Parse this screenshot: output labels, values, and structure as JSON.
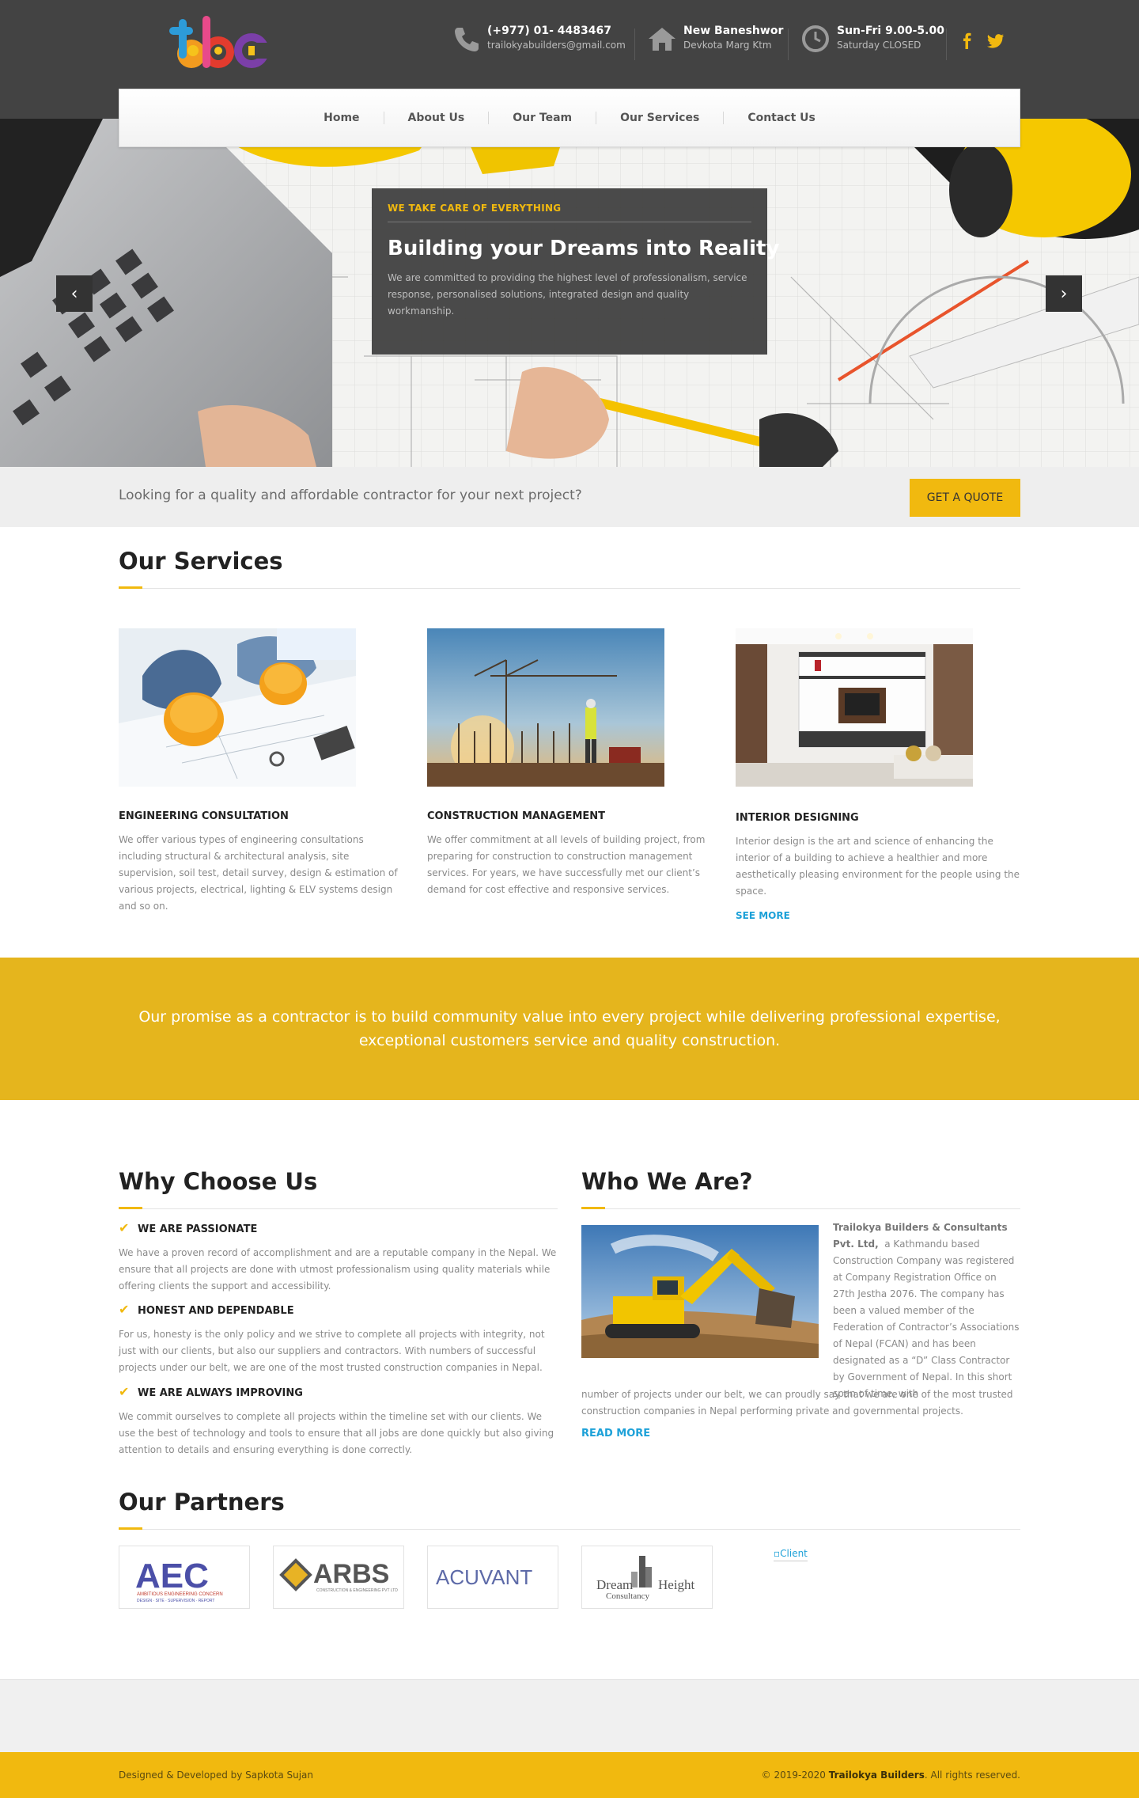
{
  "brand": {
    "logo_text": "tbc",
    "accent": "#f1b90f"
  },
  "header": {
    "phone": {
      "line1": "(+977) 01- 4483467",
      "line2": "trailokyabuilders@gmail.com",
      "icon": "phone-icon"
    },
    "address": {
      "line1": "New Baneshwor",
      "line2": "Devkota Marg Ktm",
      "icon": "home-icon"
    },
    "hours": {
      "line1": "Sun-Fri 9.00-5.00",
      "line2": "Saturday CLOSED",
      "icon": "clock-icon"
    },
    "social": [
      "facebook-icon",
      "twitter-icon"
    ]
  },
  "nav": {
    "items": [
      "Home",
      "About Us",
      "Our Team",
      "Our Services",
      "Contact Us"
    ]
  },
  "hero": {
    "kicker": "WE TAKE CARE OF EVERYTHING",
    "title": "Building your Dreams into Reality",
    "text": "We are committed to providing the highest level of professionalism, service response, personalised solutions, integrated design and quality workmanship.",
    "prev": "‹",
    "next": "›"
  },
  "quote": {
    "text": "Looking for a quality and affordable contractor for your next project?",
    "button": "GET A QUOTE"
  },
  "services": {
    "heading": "Our Services",
    "items": [
      {
        "title": "ENGINEERING CONSULTATION",
        "text": "We offer various types of engineering consultations including structural & architectural analysis, site supervision, soil test, detail survey, design & estimation of various projects, electrical, lighting & ELV systems design and so on."
      },
      {
        "title": "CONSTRUCTION MANAGEMENT",
        "text": "We offer commitment at all levels of building project, from preparing for construction to construction management services. For years, we have successfully met our client’s demand for cost effective and responsive services."
      },
      {
        "title": "INTERIOR DESIGNING",
        "text": "Interior design is the art and science of enhancing the interior of a building to achieve a healthier and more aesthetically pleasing environment for the people using the space.",
        "link": "SEE MORE"
      }
    ]
  },
  "promise": {
    "text": "Our promise as a contractor is to build community value into every project while delivering professional expertise, exceptional customers service and quality construction."
  },
  "why": {
    "heading": "Why Choose Us",
    "items": [
      {
        "title": "WE ARE PASSIONATE",
        "text": "We have a proven record of accomplishment and are a reputable company in the Nepal. We ensure that all projects are done with utmost professionalism using quality materials while offering clients the support and accessibility."
      },
      {
        "title": "HONEST AND DEPENDABLE",
        "text": "For us, honesty is the only policy and we strive to complete all projects with integrity, not just with our clients, but also our suppliers and contractors. With numbers of successful projects under our belt, we are one of the most trusted construction companies in Nepal."
      },
      {
        "title": "WE ARE ALWAYS IMPROVING",
        "text": "We commit ourselves to complete all projects within the timeline set with our clients. We use the best of technology and tools to ensure that all jobs are done quickly but also giving attention to details and ensuring everything is done correctly."
      }
    ]
  },
  "who": {
    "heading": "Who We Are?",
    "company": "Trailokya Builders & Consultants Pvt. Ltd,",
    "text_side": "a Kathmandu based Construction Company was registered at Company Registration Office on 27th Jestha 2076. The company has been a valued member of the Federation of Contractor’s Associations of Nepal (FCAN) and has been designated as a “D” Class Contractor by Government of Nepal. In this short span of time, with",
    "text_full": "number of projects under our belt, we can proudly say that we are one of the most trusted construction companies in Nepal performing private and governmental projects.",
    "link": "READ MORE"
  },
  "partners": {
    "heading": "Our Partners",
    "logos": [
      {
        "name": "AEC",
        "sub": "AMBITIOUS ENGINEERING CONCERN",
        "sub2": "DESIGN · SITE · SUPERVISION · REPORT"
      },
      {
        "name": "ARBS",
        "sub": "CONSTRUCTION & ENGINEERING PVT LTD"
      },
      {
        "name": "ACUVANT"
      },
      {
        "name": "Dream",
        "name2": "Height",
        "sub": "Consultancy"
      }
    ],
    "broken_alt": "Client"
  },
  "footer": {
    "left": "Designed & Developed by Sapkota Sujan",
    "copy_prefix": "© 2019-2020",
    "copy_brand": "Trailokya Builders",
    "copy_suffix": ". All rights reserved."
  }
}
